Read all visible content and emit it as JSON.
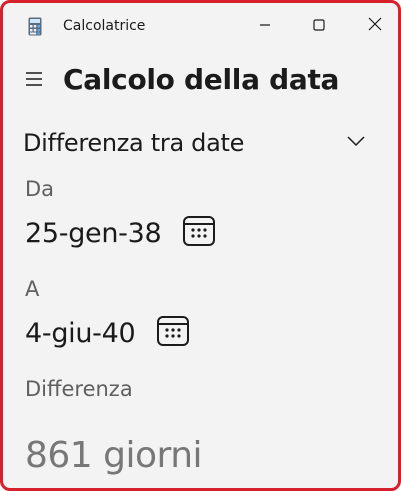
{
  "window": {
    "title": "Calcolatrice",
    "accent_border": "#d6202c"
  },
  "icons": {
    "app": "calculator-icon",
    "minimize": "minimize-icon",
    "maximize": "maximize-icon",
    "close": "close-icon",
    "menu": "hamburger-icon",
    "mode_dropdown": "chevron-down-icon",
    "date_picker": "calendar-icon"
  },
  "header": {
    "title": "Calcolo della data"
  },
  "mode": {
    "selected": "Differenza tra date"
  },
  "from": {
    "label": "Da",
    "value": "25-gen-38"
  },
  "to": {
    "label": "A",
    "value": "4-giu-40"
  },
  "result": {
    "label": "Differenza",
    "value": "861 giorni"
  }
}
